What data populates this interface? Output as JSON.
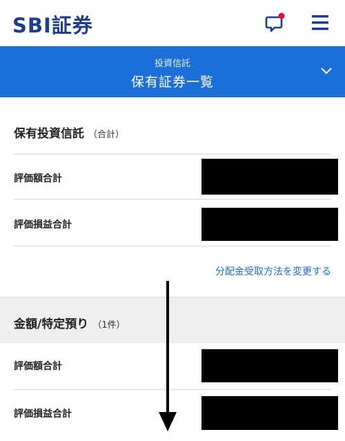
{
  "header": {
    "logo_text": "SBI証券",
    "brand_color": "#1e3d8f",
    "icons": [
      "chat-notification-icon",
      "hamburger-menu-icon"
    ]
  },
  "titlebar": {
    "subtitle": "投資信託",
    "title": "保有証券一覧",
    "background": "#1a6fd8"
  },
  "section1": {
    "title": "保有投資信託",
    "title_suffix": "（合計）",
    "rows": [
      {
        "label": "評価額合計",
        "value_redacted": true
      },
      {
        "label": "評価損益合計",
        "value_redacted": true
      }
    ],
    "link": "分配金受取方法を変更する"
  },
  "section2": {
    "title": "金額/特定預り",
    "title_suffix": "（1件）",
    "rows": [
      {
        "label": "評価額合計",
        "value_redacted": true
      },
      {
        "label": "評価損益合計",
        "value_redacted": true
      }
    ]
  }
}
